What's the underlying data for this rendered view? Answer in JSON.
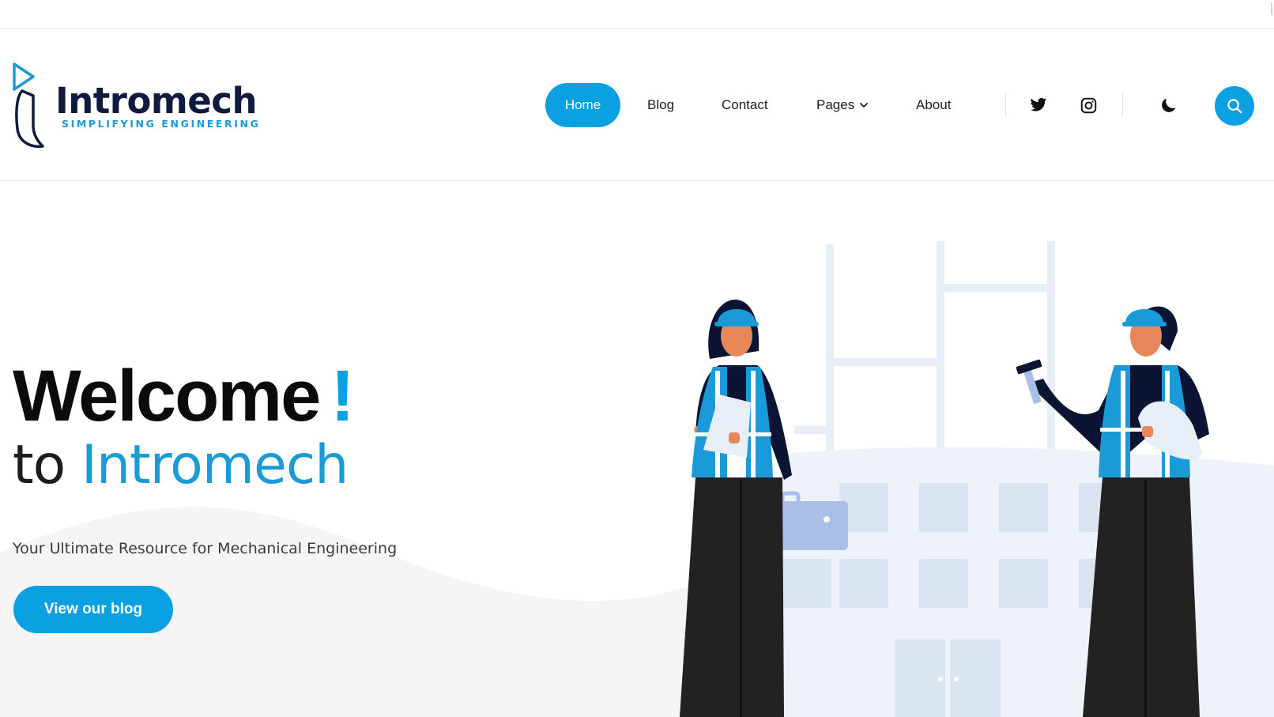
{
  "brand": {
    "name": "Intromech",
    "tagline": "SIMPLIFYING ENGINEERING"
  },
  "nav": {
    "items": [
      {
        "label": "Home",
        "active": true
      },
      {
        "label": "Blog"
      },
      {
        "label": "Contact"
      },
      {
        "label": "Pages",
        "has_dropdown": true
      },
      {
        "label": "About"
      }
    ]
  },
  "header_icons": {
    "social": [
      "twitter-icon",
      "instagram-icon"
    ],
    "theme_toggle": "moon-icon",
    "search": "search-icon"
  },
  "hero": {
    "welcome": "Welcome",
    "exclamation": "!",
    "to": "to",
    "brand": "Intromech",
    "tagline": "Your Ultimate Resource for Mechanical Engineering",
    "cta_label": "View our blog"
  },
  "colors": {
    "accent": "#0ba0e2",
    "brand_dark": "#101a3e",
    "text": "#111111"
  }
}
